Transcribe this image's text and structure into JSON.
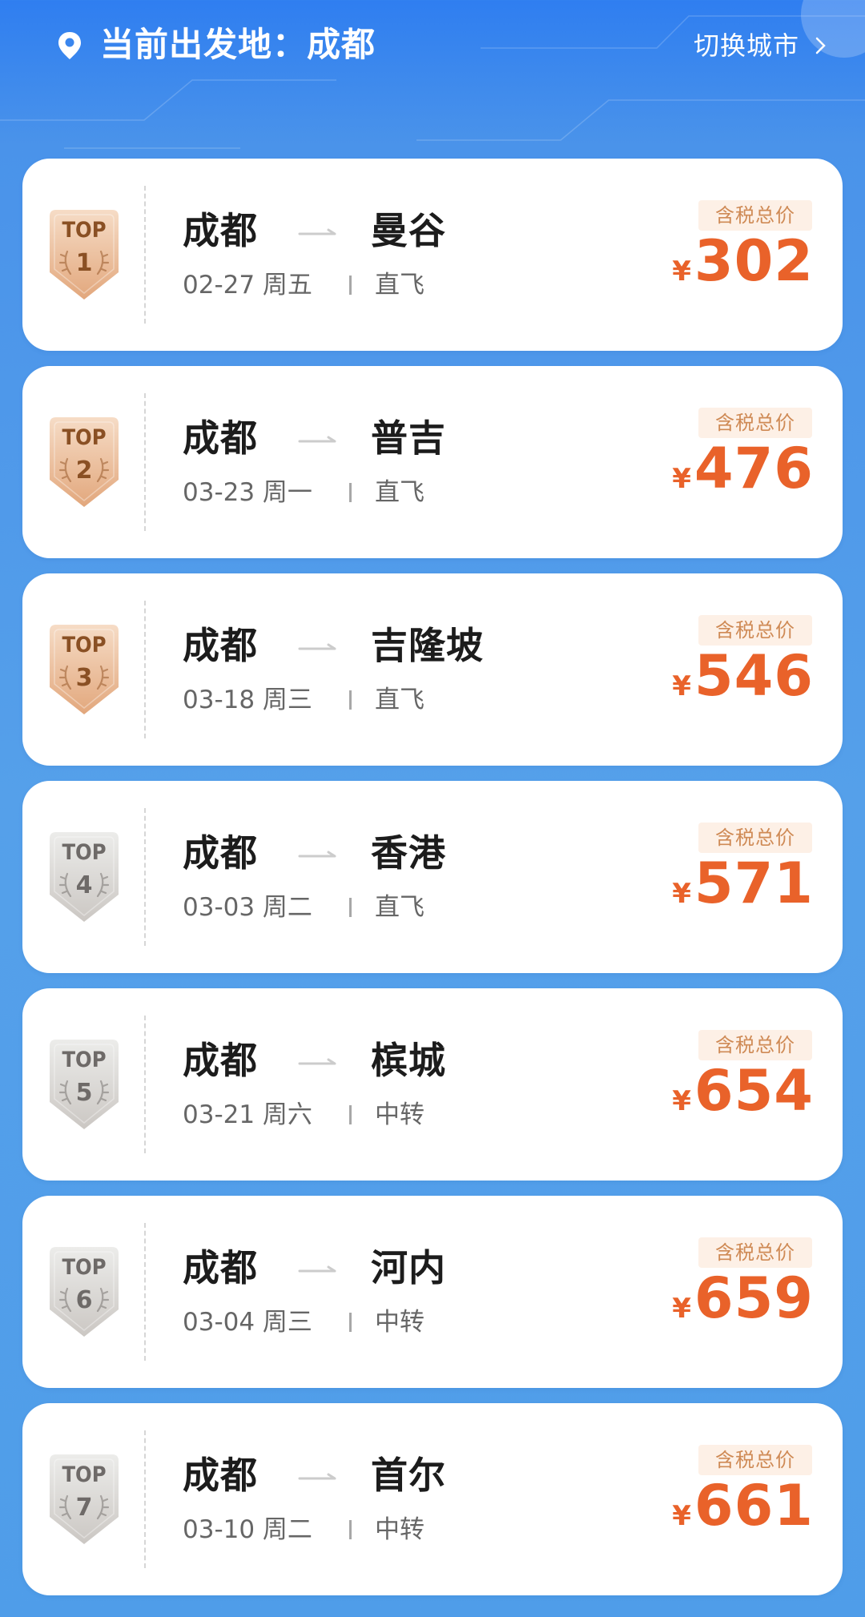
{
  "header": {
    "label": "当前出发地：成都",
    "switch_city": "切换城市"
  },
  "colors": {
    "header_blue": "#2f7ef0",
    "price_orange": "#e9622a",
    "tag_bg": "#fdf0e6",
    "tag_text": "#cf8a55",
    "gold_badge": "#e8b890",
    "silver_badge": "#d6d3d0"
  },
  "routes": [
    {
      "rank_label": "TOP",
      "rank": "1",
      "from": "成都",
      "to": "曼谷",
      "date": "02-27 周五",
      "type": "直飞",
      "tax_label": "含税总价",
      "currency": "¥",
      "price": "302",
      "badge_style": "gold"
    },
    {
      "rank_label": "TOP",
      "rank": "2",
      "from": "成都",
      "to": "普吉",
      "date": "03-23 周一",
      "type": "直飞",
      "tax_label": "含税总价",
      "currency": "¥",
      "price": "476",
      "badge_style": "gold"
    },
    {
      "rank_label": "TOP",
      "rank": "3",
      "from": "成都",
      "to": "吉隆坡",
      "date": "03-18 周三",
      "type": "直飞",
      "tax_label": "含税总价",
      "currency": "¥",
      "price": "546",
      "badge_style": "gold"
    },
    {
      "rank_label": "TOP",
      "rank": "4",
      "from": "成都",
      "to": "香港",
      "date": "03-03 周二",
      "type": "直飞",
      "tax_label": "含税总价",
      "currency": "¥",
      "price": "571",
      "badge_style": "silver"
    },
    {
      "rank_label": "TOP",
      "rank": "5",
      "from": "成都",
      "to": "槟城",
      "date": "03-21 周六",
      "type": "中转",
      "tax_label": "含税总价",
      "currency": "¥",
      "price": "654",
      "badge_style": "silver"
    },
    {
      "rank_label": "TOP",
      "rank": "6",
      "from": "成都",
      "to": "河内",
      "date": "03-04 周三",
      "type": "中转",
      "tax_label": "含税总价",
      "currency": "¥",
      "price": "659",
      "badge_style": "silver"
    },
    {
      "rank_label": "TOP",
      "rank": "7",
      "from": "成都",
      "to": "首尔",
      "date": "03-10 周二",
      "type": "中转",
      "tax_label": "含税总价",
      "currency": "¥",
      "price": "661",
      "badge_style": "silver"
    }
  ]
}
